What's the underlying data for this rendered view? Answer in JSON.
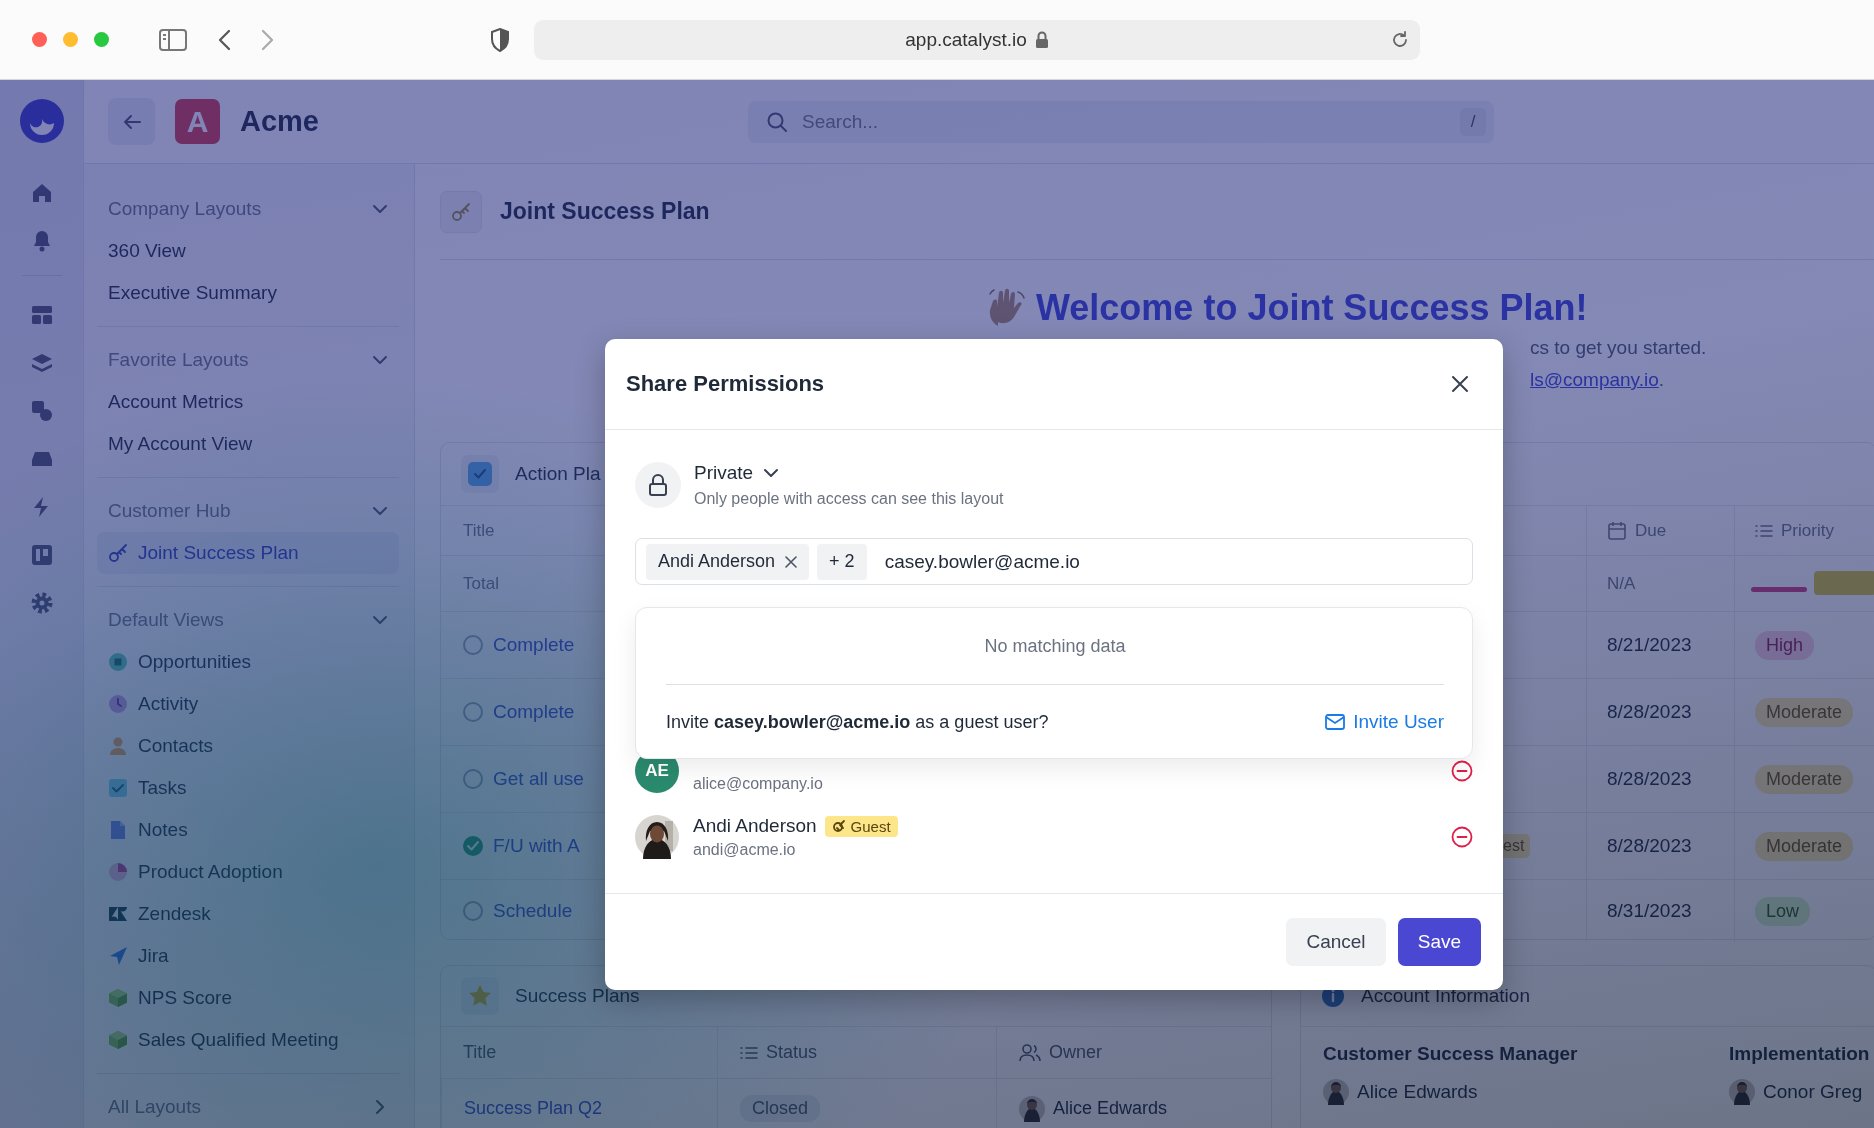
{
  "browser": {
    "url": "app.catalyst.io"
  },
  "header": {
    "workspace_initial": "A",
    "workspace": "Acme",
    "search": {
      "placeholder": "Search...",
      "shortcut": "/"
    }
  },
  "sidebar": {
    "sections": [
      {
        "title": "Company Layouts",
        "expanded": true,
        "items": [
          {
            "label": "360 View",
            "selected": false
          },
          {
            "label": "Executive Summary",
            "selected": false
          }
        ]
      },
      {
        "title": "Favorite Layouts",
        "expanded": true,
        "items": [
          {
            "label": "Account Metrics",
            "selected": false
          },
          {
            "label": "My Account View",
            "selected": false
          }
        ]
      },
      {
        "title": "Customer Hub",
        "expanded": true,
        "items": [
          {
            "label": "Joint Success Plan",
            "selected": true,
            "kind": "key"
          }
        ]
      },
      {
        "title": "Default Views",
        "expanded": true,
        "items": [
          {
            "label": "Opportunities",
            "selected": false,
            "kind": "opportunity"
          },
          {
            "label": "Activity",
            "selected": false,
            "kind": "clock"
          },
          {
            "label": "Contacts",
            "selected": false,
            "kind": "person"
          },
          {
            "label": "Tasks",
            "selected": false,
            "kind": "task"
          },
          {
            "label": "Notes",
            "selected": false,
            "kind": "note"
          },
          {
            "label": "Product Adoption",
            "selected": false,
            "kind": "pie"
          },
          {
            "label": "Zendesk",
            "selected": false,
            "kind": "zmark"
          },
          {
            "label": "Jira",
            "selected": false,
            "kind": "arrowmark"
          },
          {
            "label": "NPS Score",
            "selected": false,
            "kind": "cube"
          },
          {
            "label": "Sales Qualified Meeting",
            "selected": false,
            "kind": "cube"
          }
        ]
      },
      {
        "title": "All Layouts",
        "expanded": false
      }
    ]
  },
  "page": {
    "title": "Joint Success Plan",
    "welcome": {
      "heading": "Welcome to Joint Success Plan!",
      "subtext": "cs to get you started.",
      "link": "ls@company.io",
      "link_suffix": "."
    }
  },
  "action_plan": {
    "title": "Action Pla",
    "columns": {
      "title": "Title",
      "due": "Due",
      "priority": "Priority"
    },
    "total": {
      "label": "Total",
      "due": "N/A"
    },
    "rows": [
      {
        "title": "Complete",
        "done": false,
        "due": "8/21/2023",
        "priority": "High",
        "kind": "high"
      },
      {
        "title": "Complete",
        "done": false,
        "due": "8/28/2023",
        "priority": "Moderate",
        "kind": "moderate"
      },
      {
        "title": "Get all use",
        "done": false,
        "due": "8/28/2023",
        "priority": "Moderate",
        "kind": "moderate"
      },
      {
        "title": "F/U with A",
        "done": true,
        "column_3": "est",
        "due": "8/28/2023",
        "priority": "Moderate",
        "kind": "moderate"
      },
      {
        "title": "Schedule",
        "done": false,
        "due": "8/31/2023",
        "priority": "Low",
        "kind": "low"
      }
    ]
  },
  "success_plans": {
    "title": "Success Plans",
    "columns": {
      "title": "Title",
      "status": "Status",
      "owner": "Owner"
    },
    "rows": [
      {
        "title": "Success Plan Q2",
        "status": "Closed",
        "owner": "Alice Edwards"
      }
    ]
  },
  "account_information": {
    "title": "Account Information",
    "fields": [
      {
        "label": "Customer Success Manager",
        "value": "Alice Edwards"
      },
      {
        "label": "Implementation",
        "value": "Conor Greg"
      }
    ]
  },
  "share_dialog": {
    "title": "Share Permissions",
    "visibility": {
      "label": "Private",
      "description": "Only people with access can see this layout"
    },
    "invitees": [
      {
        "label": "Andi Anderson",
        "removable": true
      }
    ],
    "more_count": "+ 2",
    "input_value": "casey.bowler@acme.io",
    "suggestions": {
      "empty_text": "No matching data",
      "invite_prompt": "Invite **casey.bowler@acme.io** as a guest user?",
      "invite_action": "Invite User"
    },
    "members": [
      {
        "kind": "initials",
        "initials": "AE",
        "email": "alice@company.io"
      },
      {
        "name": "Andi Anderson",
        "badge": "Guest",
        "email": "andi@acme.io"
      }
    ],
    "buttons": {
      "cancel": "Cancel",
      "save": "Save"
    }
  }
}
